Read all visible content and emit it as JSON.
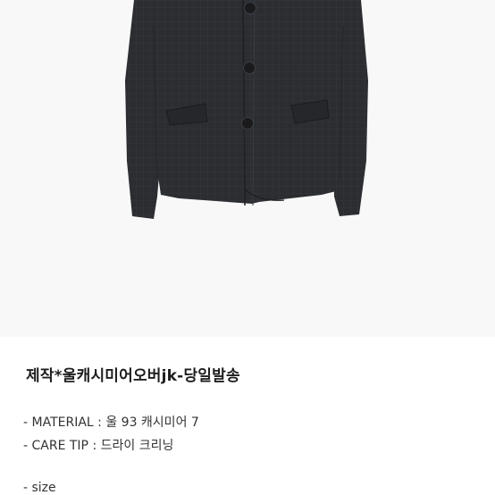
{
  "product": {
    "image_alt": "charcoal wool cashmere jacket",
    "title": "제작*울캐시미어오버jk-당일발송"
  },
  "details": [
    {
      "prefix": "- MATERIAL : ",
      "value": "울 93 캐시미어 7"
    },
    {
      "prefix": "- CARE TIP : ",
      "value": "드라이 크리닝"
    },
    {
      "prefix": "- size",
      "value": ""
    }
  ],
  "colors": {
    "jacket": "#2b2d31",
    "background": "#f8f8f8",
    "text": "#333333"
  }
}
